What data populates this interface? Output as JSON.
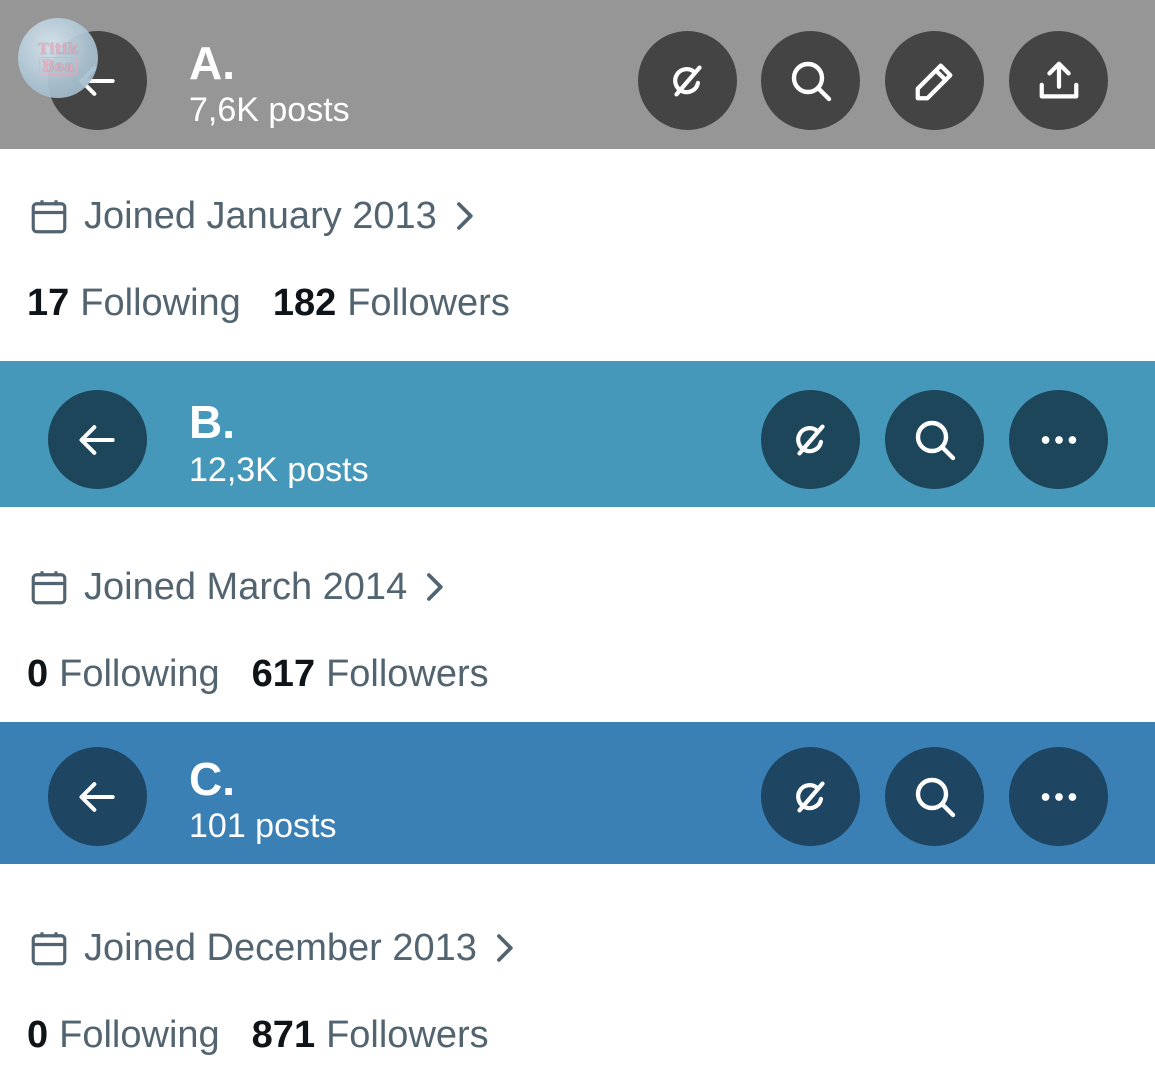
{
  "profiles": [
    {
      "name": "A.",
      "posts": "7,6K posts",
      "joined": "Joined January 2013",
      "following_count": "17",
      "following_label": "Following",
      "followers_count": "182",
      "followers_label": "Followers",
      "header_color": "#969696",
      "button_color": "#444444",
      "buttons": [
        "grok-icon",
        "search-icon",
        "edit-icon",
        "share-icon"
      ]
    },
    {
      "name": "B.",
      "posts": "12,3K posts",
      "joined": "Joined March 2014",
      "following_count": "0",
      "following_label": "Following",
      "followers_count": "617",
      "followers_label": "Followers",
      "header_color": "#4598b9",
      "button_color": "#1d465b",
      "buttons": [
        "grok-icon",
        "search-icon",
        "more-icon"
      ]
    },
    {
      "name": "C.",
      "posts": "101 posts",
      "joined": "Joined December 2013",
      "following_count": "0",
      "following_label": "Following",
      "followers_count": "871",
      "followers_label": "Followers",
      "header_color": "#3a80b4",
      "button_color": "#1e4562",
      "buttons": [
        "grok-icon",
        "search-icon",
        "more-icon"
      ]
    }
  ],
  "watermark": {
    "line1": "Titik",
    "line2": "Bea"
  },
  "colors": {
    "secondary_text": "#536471",
    "primary_text": "#0f1419"
  }
}
